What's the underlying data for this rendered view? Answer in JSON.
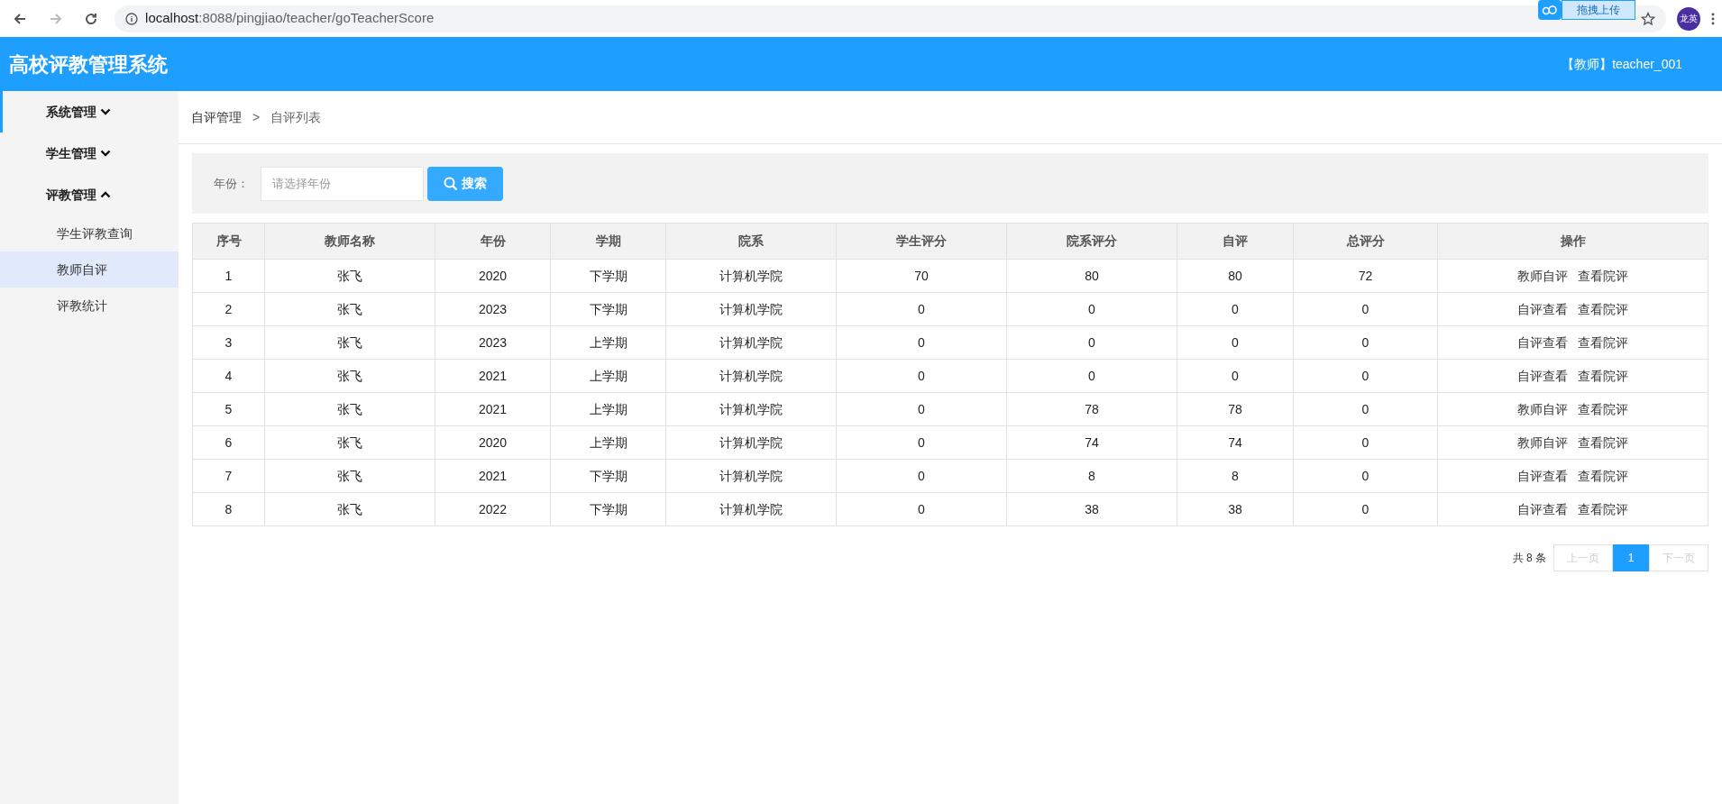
{
  "browser": {
    "url_host": "localhost",
    "url_rest": ":8088/pingjiao/teacher/goTeacherScore",
    "extension_label": "拖拽上传",
    "profile": "龙英",
    "back_disabled": false,
    "forward_disabled": true
  },
  "header": {
    "title": "高校评教管理系统",
    "user": "【教师】teacher_001"
  },
  "sidebar": {
    "groups": [
      {
        "label": "系统管理",
        "expanded": false,
        "hovered": true
      },
      {
        "label": "学生管理",
        "expanded": false,
        "hovered": false
      },
      {
        "label": "评教管理",
        "expanded": true,
        "hovered": false,
        "children": [
          {
            "label": "学生评教查询",
            "selected": false
          },
          {
            "label": "教师自评",
            "selected": true
          },
          {
            "label": "评教统计",
            "selected": false
          }
        ]
      }
    ]
  },
  "breadcrumb": [
    "自评管理",
    "自评列表"
  ],
  "breadcrumb_separator": ">",
  "search": {
    "label": "年份：",
    "placeholder": "请选择年份",
    "button": "搜索"
  },
  "table": {
    "columns": [
      "序号",
      "教师名称",
      "年份",
      "学期",
      "院系",
      "学生评分",
      "院系评分",
      "自评",
      "总评分",
      "操作"
    ],
    "rows": [
      {
        "cells": [
          "1",
          "张飞",
          "2020",
          "下学期",
          "计算机学院",
          "70",
          "80",
          "80",
          "72"
        ],
        "actions": [
          "教师自评",
          "查看院评"
        ]
      },
      {
        "cells": [
          "2",
          "张飞",
          "2023",
          "下学期",
          "计算机学院",
          "0",
          "0",
          "0",
          "0"
        ],
        "actions": [
          "自评查看",
          "查看院评"
        ]
      },
      {
        "cells": [
          "3",
          "张飞",
          "2023",
          "上学期",
          "计算机学院",
          "0",
          "0",
          "0",
          "0"
        ],
        "actions": [
          "自评查看",
          "查看院评"
        ]
      },
      {
        "cells": [
          "4",
          "张飞",
          "2021",
          "上学期",
          "计算机学院",
          "0",
          "0",
          "0",
          "0"
        ],
        "actions": [
          "自评查看",
          "查看院评"
        ]
      },
      {
        "cells": [
          "5",
          "张飞",
          "2021",
          "上学期",
          "计算机学院",
          "0",
          "78",
          "78",
          "0"
        ],
        "actions": [
          "教师自评",
          "查看院评"
        ]
      },
      {
        "cells": [
          "6",
          "张飞",
          "2020",
          "上学期",
          "计算机学院",
          "0",
          "74",
          "74",
          "0"
        ],
        "actions": [
          "教师自评",
          "查看院评"
        ]
      },
      {
        "cells": [
          "7",
          "张飞",
          "2021",
          "下学期",
          "计算机学院",
          "0",
          "8",
          "8",
          "0"
        ],
        "actions": [
          "自评查看",
          "查看院评"
        ]
      },
      {
        "cells": [
          "8",
          "张飞",
          "2022",
          "下学期",
          "计算机学院",
          "0",
          "38",
          "38",
          "0"
        ],
        "actions": [
          "自评查看",
          "查看院评"
        ]
      }
    ]
  },
  "pagination": {
    "total": "共 8 条",
    "prev": {
      "label": "上一页",
      "disabled": true
    },
    "pages": [
      {
        "label": "1",
        "selected": true
      }
    ],
    "next": {
      "label": "下一页",
      "disabled": true
    }
  }
}
